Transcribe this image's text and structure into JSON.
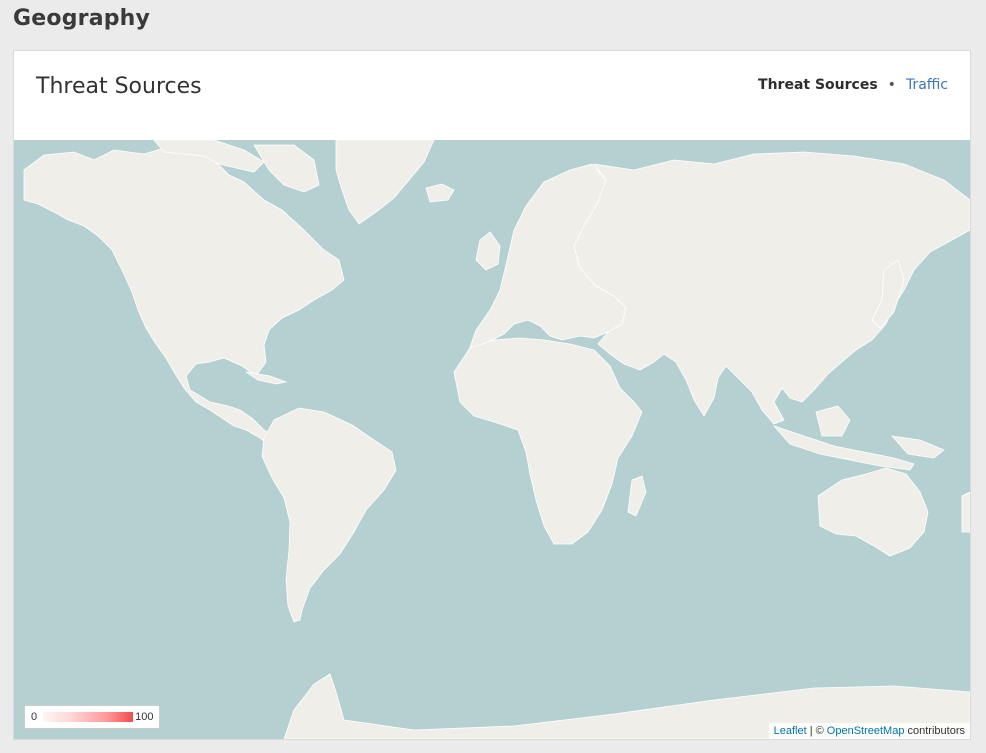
{
  "page": {
    "section_title": "Geography"
  },
  "card": {
    "title": "Threat Sources",
    "view_switch": {
      "active_label": "Threat Sources",
      "separator": "•",
      "inactive_label": "Traffic"
    }
  },
  "map": {
    "colors": {
      "water": "#b5d0d0",
      "land": "#f0eee9",
      "borders": "#ffffff"
    },
    "legend": {
      "min_label": "0",
      "max_label": "100",
      "scale_colors": [
        "#fff5f5",
        "#ffd8d8",
        "#ff9a9a",
        "#f44a4a"
      ]
    },
    "attribution": {
      "leaflet_link": "Leaflet",
      "separator": "| ©",
      "osm_link": "OpenStreetMap",
      "suffix": "contributors"
    }
  }
}
